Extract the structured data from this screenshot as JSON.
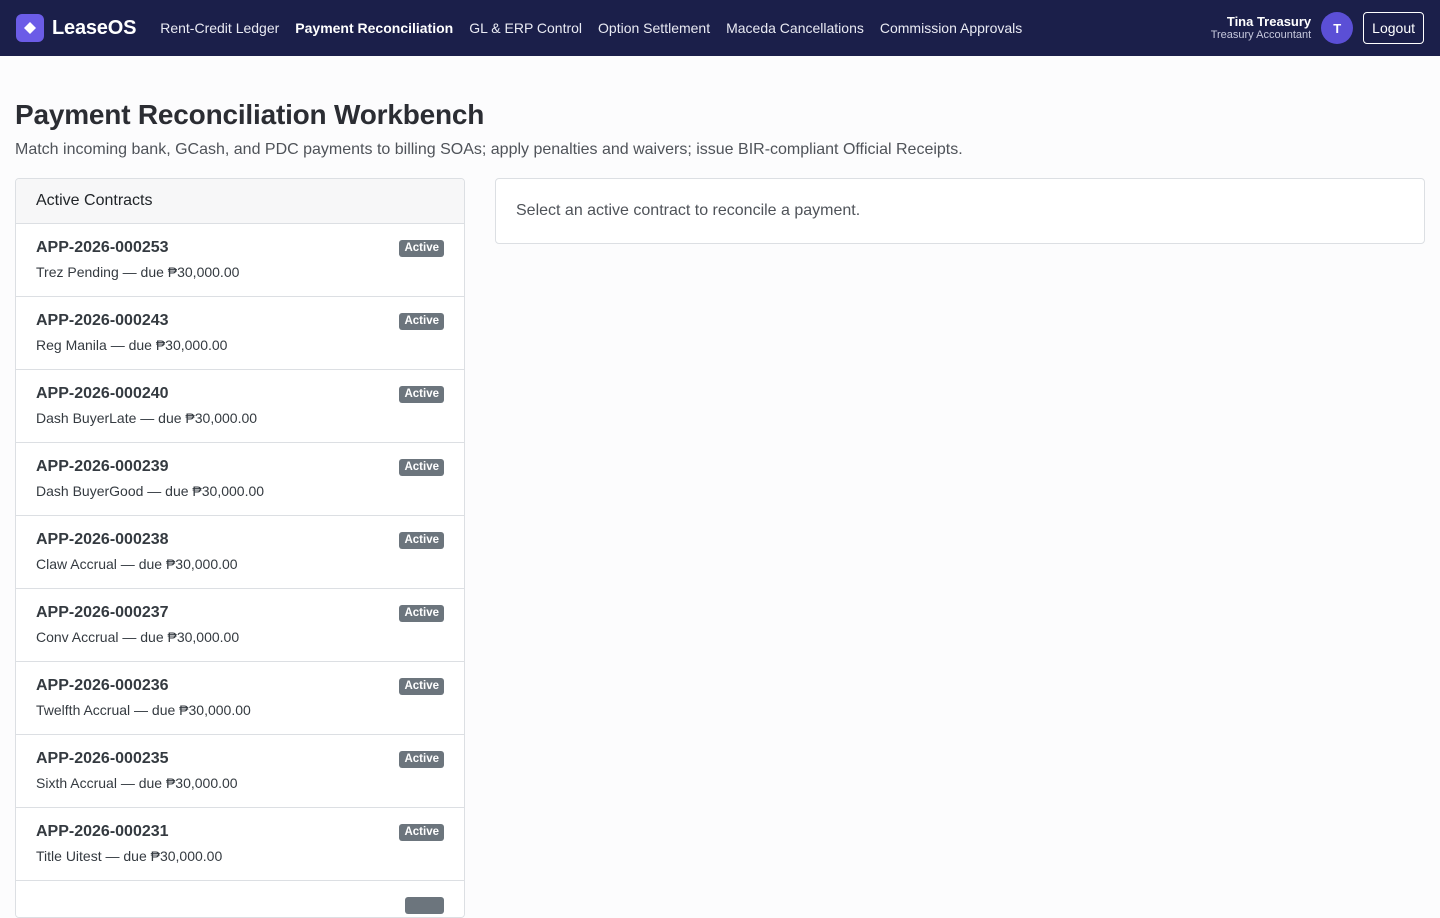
{
  "app": {
    "name": "LeaseOS"
  },
  "nav": {
    "items": [
      {
        "label": "Rent-Credit Ledger",
        "active": false
      },
      {
        "label": "Payment Reconciliation",
        "active": true
      },
      {
        "label": "GL & ERP Control",
        "active": false
      },
      {
        "label": "Option Settlement",
        "active": false
      },
      {
        "label": "Maceda Cancellations",
        "active": false
      },
      {
        "label": "Commission Approvals",
        "active": false
      }
    ]
  },
  "user": {
    "name": "Tina Treasury",
    "role": "Treasury Accountant",
    "initial": "T",
    "logout_label": "Logout"
  },
  "page": {
    "title": "Payment Reconciliation Workbench",
    "subtitle": "Match incoming bank, GCash, and PDC payments to billing SOAs; apply penalties and waivers; issue BIR-compliant Official Receipts."
  },
  "contracts": {
    "header": "Active Contracts",
    "items": [
      {
        "id": "APP-2026-000253",
        "desc": "Trez Pending — due ₱30,000.00",
        "status": "Active"
      },
      {
        "id": "APP-2026-000243",
        "desc": "Reg Manila — due ₱30,000.00",
        "status": "Active"
      },
      {
        "id": "APP-2026-000240",
        "desc": "Dash BuyerLate — due ₱30,000.00",
        "status": "Active"
      },
      {
        "id": "APP-2026-000239",
        "desc": "Dash BuyerGood — due ₱30,000.00",
        "status": "Active"
      },
      {
        "id": "APP-2026-000238",
        "desc": "Claw Accrual — due ₱30,000.00",
        "status": "Active"
      },
      {
        "id": "APP-2026-000237",
        "desc": "Conv Accrual — due ₱30,000.00",
        "status": "Active"
      },
      {
        "id": "APP-2026-000236",
        "desc": "Twelfth Accrual — due ₱30,000.00",
        "status": "Active"
      },
      {
        "id": "APP-2026-000235",
        "desc": "Sixth Accrual — due ₱30,000.00",
        "status": "Active"
      },
      {
        "id": "APP-2026-000231",
        "desc": "Title Uitest — due ₱30,000.00",
        "status": "Active"
      }
    ]
  },
  "detail": {
    "empty_message": "Select an active contract to reconcile a payment."
  },
  "colors": {
    "navbar_bg": "#1b1f4a",
    "brand_accent": "#6b5ce7",
    "badge_bg": "#6c757d",
    "avatar_bg": "#5b4fd6"
  }
}
